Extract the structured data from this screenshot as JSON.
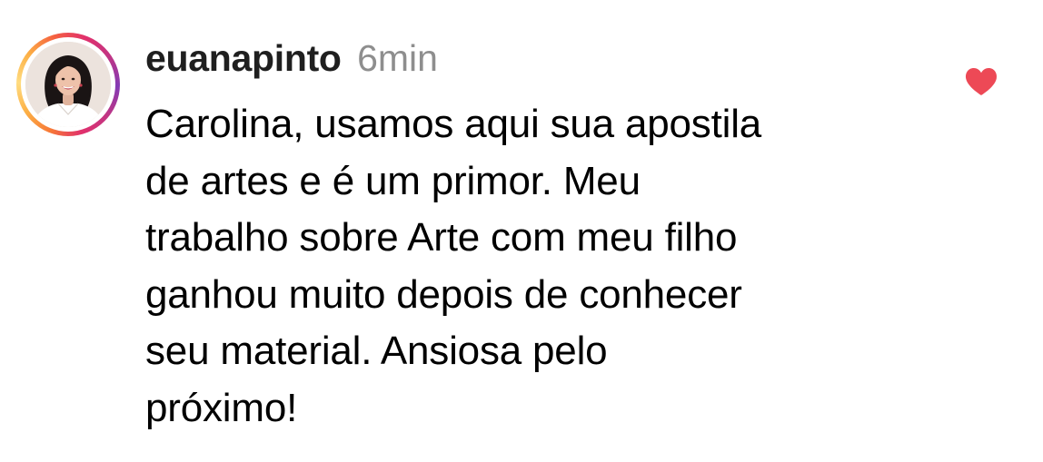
{
  "comment": {
    "username": "euanapinto",
    "time_ago": "6min",
    "text": "Carolina, usamos aqui sua apostila\nde artes e é um primor. Meu\ntrabalho sobre Arte com meu filho\nganhou muito depois de conhecer\nseu material. Ansiosa pelo\npróximo!",
    "liked": true
  },
  "colors": {
    "like": "#ed4956",
    "timestamp": "#8e8e8e",
    "story_ring": [
      "#fcaf45",
      "#f77737",
      "#e1306c",
      "#c13584",
      "#833ab4"
    ]
  },
  "icons": {
    "like": "heart-icon"
  }
}
